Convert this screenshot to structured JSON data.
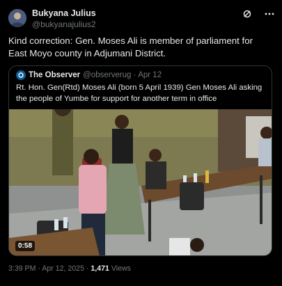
{
  "author": {
    "display_name": "Bukyana Julius",
    "handle": "@bukyanajulius2",
    "avatar_icon": "avatar-icon"
  },
  "actions": {
    "grok_icon": "grok-icon",
    "more_icon": "more-icon"
  },
  "tweet": {
    "text": "Kind correction: Gen. Moses Ali is member of parliament for East Moyo county in Adjumani District."
  },
  "quote": {
    "display_name": "The Observer",
    "handle": "@observerug",
    "separator": "·",
    "date": "Apr 12",
    "text": "Rt. Hon. Gen(Rtd) Moses Ali (born 5 April 1939) Gen Moses Ali asking the people of Yumbe for support for another term in office",
    "video_duration": "0:58"
  },
  "meta": {
    "time": "3:39 PM",
    "separator": "·",
    "date": "Apr 12, 2025",
    "views_count": "1,471",
    "views_label": "Views"
  }
}
